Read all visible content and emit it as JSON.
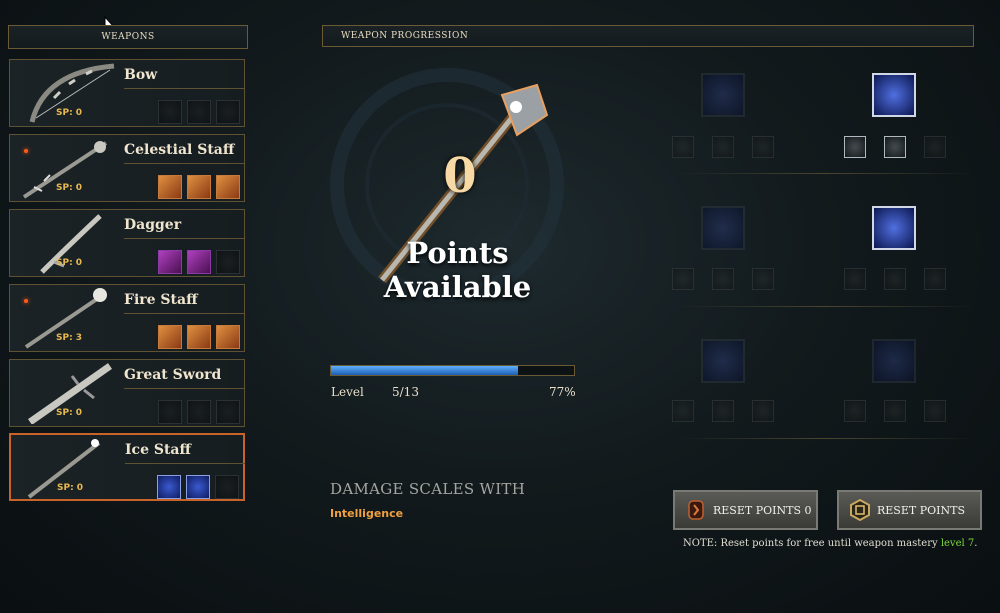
{
  "panels": {
    "weapons_title": "WEAPONS",
    "progression_title": "WEAPON PROGRESSION"
  },
  "weapons": [
    {
      "name": "Bow",
      "sp": "SP: 0",
      "selected": false
    },
    {
      "name": "Celestial Staff",
      "sp": "SP: 0",
      "selected": false
    },
    {
      "name": "Dagger",
      "sp": "SP: 0",
      "selected": false
    },
    {
      "name": "Fire Staff",
      "sp": "SP: 3",
      "selected": false
    },
    {
      "name": "Great Sword",
      "sp": "SP: 0",
      "selected": false
    },
    {
      "name": "Ice Staff",
      "sp": "SP: 0",
      "selected": true
    }
  ],
  "points": {
    "value": "0",
    "label": "Points Available"
  },
  "level": {
    "label": "Level",
    "value": "5/13",
    "percent_text": "77%",
    "progress": 0.77
  },
  "damage": {
    "title": "DAMAGE SCALES WITH",
    "attribute": "Intelligence"
  },
  "buttons": {
    "reset_paid": "RESET POINTS 0",
    "reset_free": "RESET POINTS"
  },
  "note": {
    "prefix": "NOTE: Reset points for free until weapon mastery ",
    "level": "level 7",
    "suffix": "."
  },
  "colors": {
    "accent_gold": "#f0a040",
    "sp_gold": "#e8b850",
    "selected_border": "#c8642a",
    "progress_blue": "#3a8ae0",
    "note_green": "#7ad83a"
  }
}
